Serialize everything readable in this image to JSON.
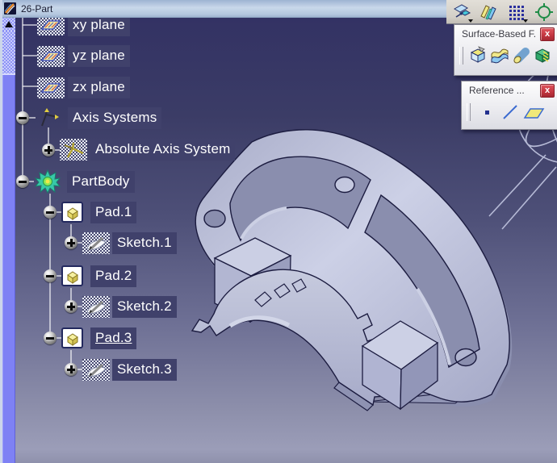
{
  "window": {
    "title": "26-Part",
    "icon": "catia-part-document-icon"
  },
  "tree": {
    "items": [
      {
        "label": "xy plane",
        "icon": "plane-icon",
        "expander": "none",
        "level": 1,
        "underlined": false
      },
      {
        "label": "yz plane",
        "icon": "plane-icon",
        "expander": "none",
        "level": 1,
        "underlined": false
      },
      {
        "label": "zx plane",
        "icon": "plane-icon",
        "expander": "none",
        "level": 1,
        "underlined": false
      },
      {
        "label": "Axis Systems",
        "icon": "axis-systems-icon",
        "expander": "minus",
        "level": 1,
        "underlined": false
      },
      {
        "label": "Absolute Axis System",
        "icon": "absolute-axis-icon",
        "expander": "plus",
        "level": 2,
        "underlined": false
      },
      {
        "label": "PartBody",
        "icon": "partbody-gear-icon",
        "expander": "minus",
        "level": 1,
        "underlined": false
      },
      {
        "label": "Pad.1",
        "icon": "pad-icon",
        "expander": "minus",
        "level": 2,
        "underlined": false
      },
      {
        "label": "Sketch.1",
        "icon": "sketch-icon",
        "expander": "plus",
        "level": 3,
        "underlined": false
      },
      {
        "label": "Pad.2",
        "icon": "pad-icon",
        "expander": "minus",
        "level": 2,
        "underlined": false
      },
      {
        "label": "Sketch.2",
        "icon": "sketch-icon",
        "expander": "plus",
        "level": 3,
        "underlined": false
      },
      {
        "label": "Pad.3",
        "icon": "pad-icon",
        "expander": "minus",
        "level": 2,
        "underlined": true
      },
      {
        "label": "Sketch.3",
        "icon": "sketch-icon",
        "expander": "plus",
        "level": 3,
        "underlined": false
      }
    ]
  },
  "toolbars": {
    "docked": {
      "icons": [
        "translation-icon",
        "mirror-icon",
        "rectangular-pattern-icon",
        "scaling-icon"
      ]
    },
    "surface_based": {
      "title": "Surface-Based F...",
      "close_label": "x",
      "icons": [
        "split-icon",
        "thick-surface-icon",
        "close-surface-icon",
        "sew-surface-icon"
      ]
    },
    "reference": {
      "title": "Reference ...",
      "close_label": "x",
      "icons": [
        "point-icon",
        "line-icon",
        "plane-icon"
      ]
    }
  },
  "viewport": {
    "background_top": "#333264",
    "background_bottom": "#9b9db8",
    "model_fill": "#b5b9d6",
    "model_edge": "#1c1c40",
    "scrollbar_color": "#7e81f4",
    "close_button_color": "#c23540",
    "titlebar_color": "#c9d8ea"
  }
}
